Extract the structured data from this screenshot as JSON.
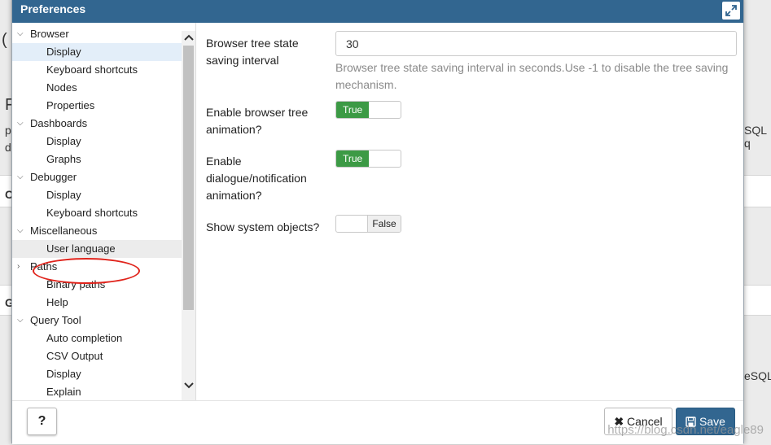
{
  "background": {
    "fragments": [
      "(",
      "F",
      "p",
      "d",
      "C",
      "G",
      "SQL q",
      "eSQL"
    ]
  },
  "dialog": {
    "title": "Preferences",
    "maximize_icon": "expand-icon"
  },
  "tree": {
    "categories": [
      {
        "label": "Browser",
        "items": [
          "Display",
          "Keyboard shortcuts",
          "Nodes",
          "Properties"
        ]
      },
      {
        "label": "Dashboards",
        "items": [
          "Display",
          "Graphs"
        ]
      },
      {
        "label": "Debugger",
        "items": [
          "Display",
          "Keyboard shortcuts"
        ]
      },
      {
        "label": "Miscellaneous",
        "items": [
          "User language"
        ]
      },
      {
        "label": "Paths",
        "items": [
          "Binary paths",
          "Help"
        ]
      },
      {
        "label": "Query Tool",
        "items": [
          "Auto completion",
          "CSV Output",
          "Display",
          "Explain"
        ]
      }
    ],
    "selected": "Browser/Display",
    "highlighted": "Miscellaneous/User language"
  },
  "form": {
    "interval_label": "Browser tree state saving interval",
    "interval_value": "30",
    "interval_help": "Browser tree state saving interval in seconds.Use -1 to disable the tree saving mechanism.",
    "tree_anim_label": "Enable browser tree animation?",
    "tree_anim_value": "True",
    "dialog_anim_label": "Enable dialogue/notification animation?",
    "dialog_anim_value": "True",
    "system_objects_label": "Show system objects?",
    "system_objects_value": "False"
  },
  "footer": {
    "help_label": "?",
    "cancel_label": "Cancel",
    "save_label": "Save"
  },
  "watermark": "https://blog.csdn.net/eagle89",
  "colors": {
    "titlebar": "#326690",
    "toggle_on": "#3c9a45",
    "annotation": "#e0231b"
  }
}
